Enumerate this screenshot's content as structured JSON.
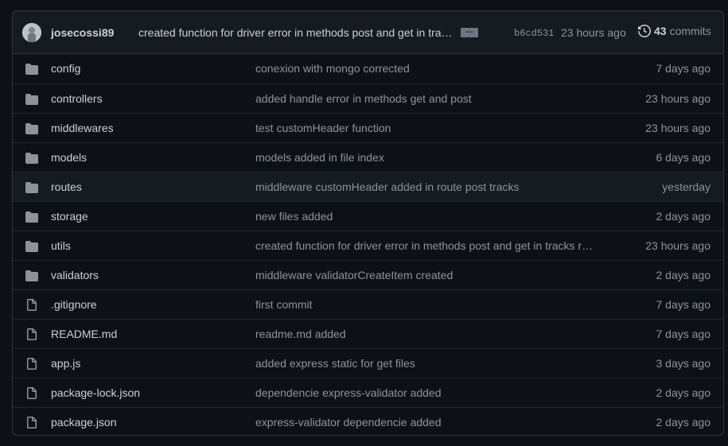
{
  "latest_commit": {
    "author": "josecossi89",
    "message": "created function for driver error in methods post and get in tracks r…",
    "ellipsis_label": "…",
    "sha": "b6cd531",
    "time": "23 hours ago",
    "commit_count": "43",
    "commits_label": "commits"
  },
  "icons": {
    "folder": "folder-icon",
    "file": "file-icon",
    "history": "history-icon"
  },
  "colors": {
    "background": "#0d1117",
    "header_bg": "#161b22",
    "border": "#30363d",
    "icon": "#8b949e"
  },
  "files": [
    {
      "type": "folder",
      "name": "config",
      "message": "conexion with mongo corrected",
      "age": "7 days ago"
    },
    {
      "type": "folder",
      "name": "controllers",
      "message": "added handle error in methods get and post",
      "age": "23 hours ago"
    },
    {
      "type": "folder",
      "name": "middlewares",
      "message": "test customHeader function",
      "age": "23 hours ago"
    },
    {
      "type": "folder",
      "name": "models",
      "message": "models added in file index",
      "age": "6 days ago"
    },
    {
      "type": "folder",
      "name": "routes",
      "message": "middleware customHeader added in route post tracks",
      "age": "yesterday"
    },
    {
      "type": "folder",
      "name": "storage",
      "message": "new files added",
      "age": "2 days ago"
    },
    {
      "type": "folder",
      "name": "utils",
      "message": "created function for driver error in methods post and get in tracks r…",
      "age": "23 hours ago"
    },
    {
      "type": "folder",
      "name": "validators",
      "message": "middleware validatorCreateItem created",
      "age": "2 days ago"
    },
    {
      "type": "file",
      "name": ".gitignore",
      "message": "first commit",
      "age": "7 days ago"
    },
    {
      "type": "file",
      "name": "README.md",
      "message": "readme.md added",
      "age": "7 days ago"
    },
    {
      "type": "file",
      "name": "app.js",
      "message": "added express static for get files",
      "age": "3 days ago"
    },
    {
      "type": "file",
      "name": "package-lock.json",
      "message": "dependencie express-validator added",
      "age": "2 days ago"
    },
    {
      "type": "file",
      "name": "package.json",
      "message": "express-validator dependencie added",
      "age": "2 days ago"
    }
  ]
}
